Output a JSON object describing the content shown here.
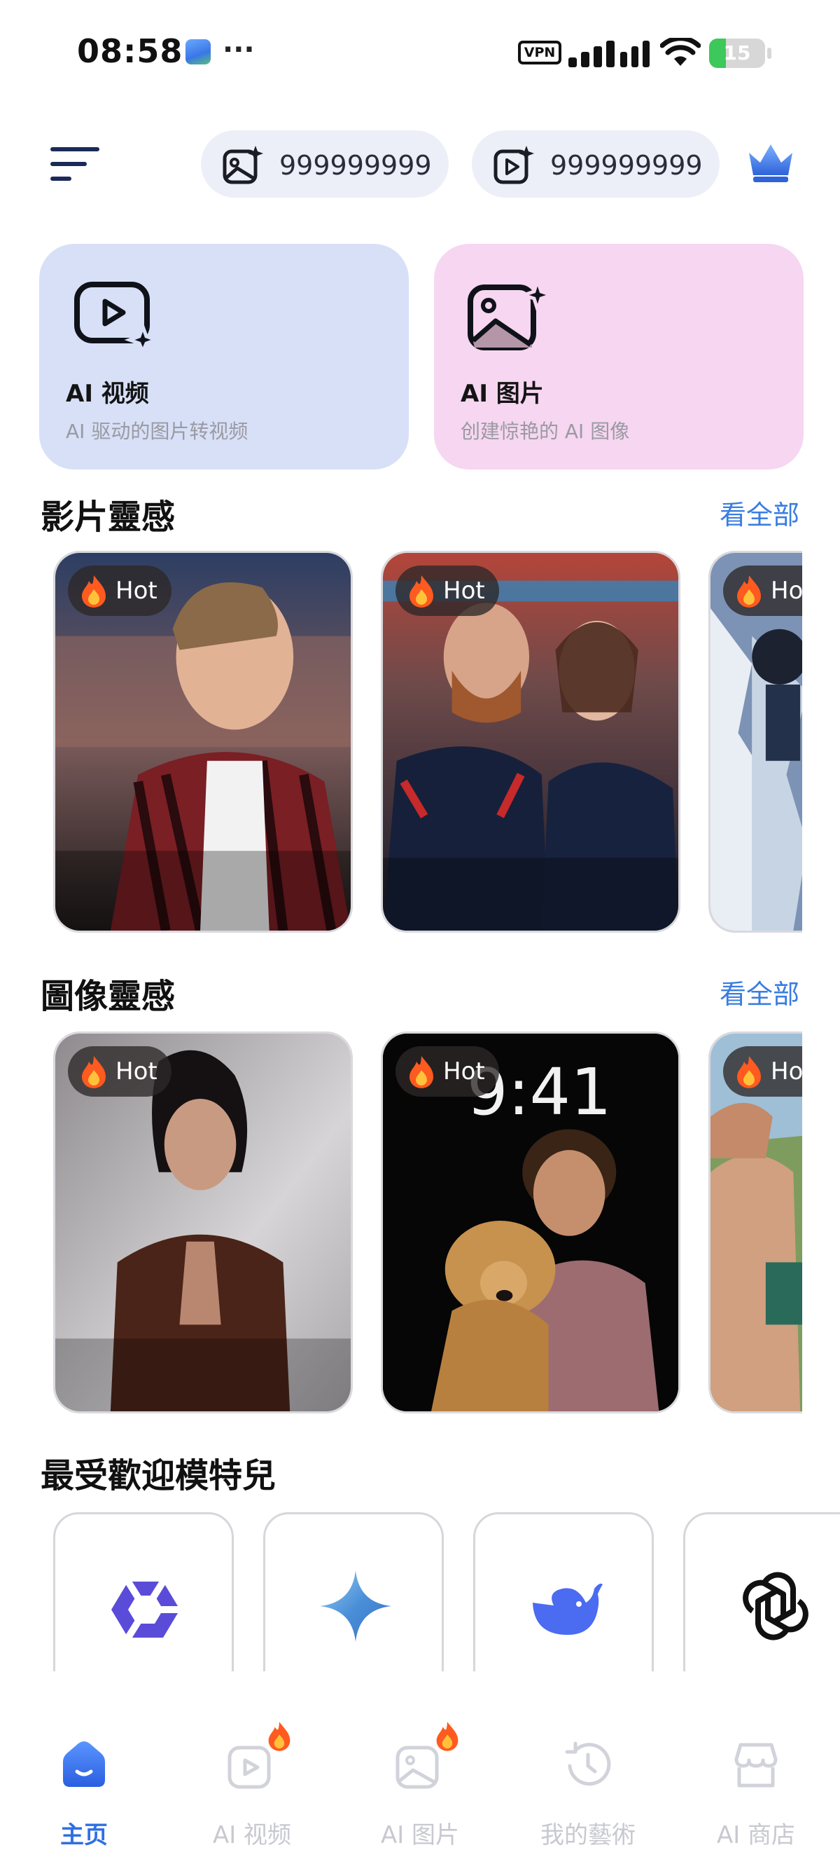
{
  "status_bar": {
    "time": "08:58",
    "dots": "···",
    "vpn": "VPN",
    "battery": "15"
  },
  "header": {
    "image_credits": "999999999",
    "video_credits": "999999999"
  },
  "features": [
    {
      "title": "AI 视频",
      "subtitle": "AI 驱动的图片转视频",
      "bg": "#d7e0f7"
    },
    {
      "title": "AI 图片",
      "subtitle": "创建惊艳的 AI 图像",
      "bg": "#f6d6f0"
    }
  ],
  "video_section": {
    "title": "影片靈感",
    "see_all": "看全部",
    "tiles": [
      {
        "badge": "Hot"
      },
      {
        "badge": "Hot"
      },
      {
        "badge": "Hot"
      }
    ]
  },
  "image_section": {
    "title": "圖像靈感",
    "see_all": "看全部",
    "tiles": [
      {
        "badge": "Hot"
      },
      {
        "badge": "Hot",
        "overlay_clock": "9:41"
      },
      {
        "badge": "Hot"
      }
    ]
  },
  "models_section": {
    "title": "最受歡迎模特兒",
    "models": [
      {
        "icon": "qwen-logo-icon"
      },
      {
        "icon": "gemini-sparkle-icon"
      },
      {
        "icon": "deepseek-whale-icon"
      },
      {
        "icon": "openai-logo-icon"
      }
    ]
  },
  "bottom_nav": {
    "items": [
      {
        "label": "主页",
        "icon": "home-icon",
        "active": true
      },
      {
        "label": "AI 视频",
        "icon": "video-sparkle-icon",
        "hot": true
      },
      {
        "label": "AI 图片",
        "icon": "image-sparkle-icon",
        "hot": true
      },
      {
        "label": "我的藝術",
        "icon": "history-icon"
      },
      {
        "label": "AI 商店",
        "icon": "store-icon"
      }
    ]
  },
  "colors": {
    "accent": "#2f6fe3",
    "link": "#3a7de0",
    "hot_badge_bg": "#2d2828"
  }
}
